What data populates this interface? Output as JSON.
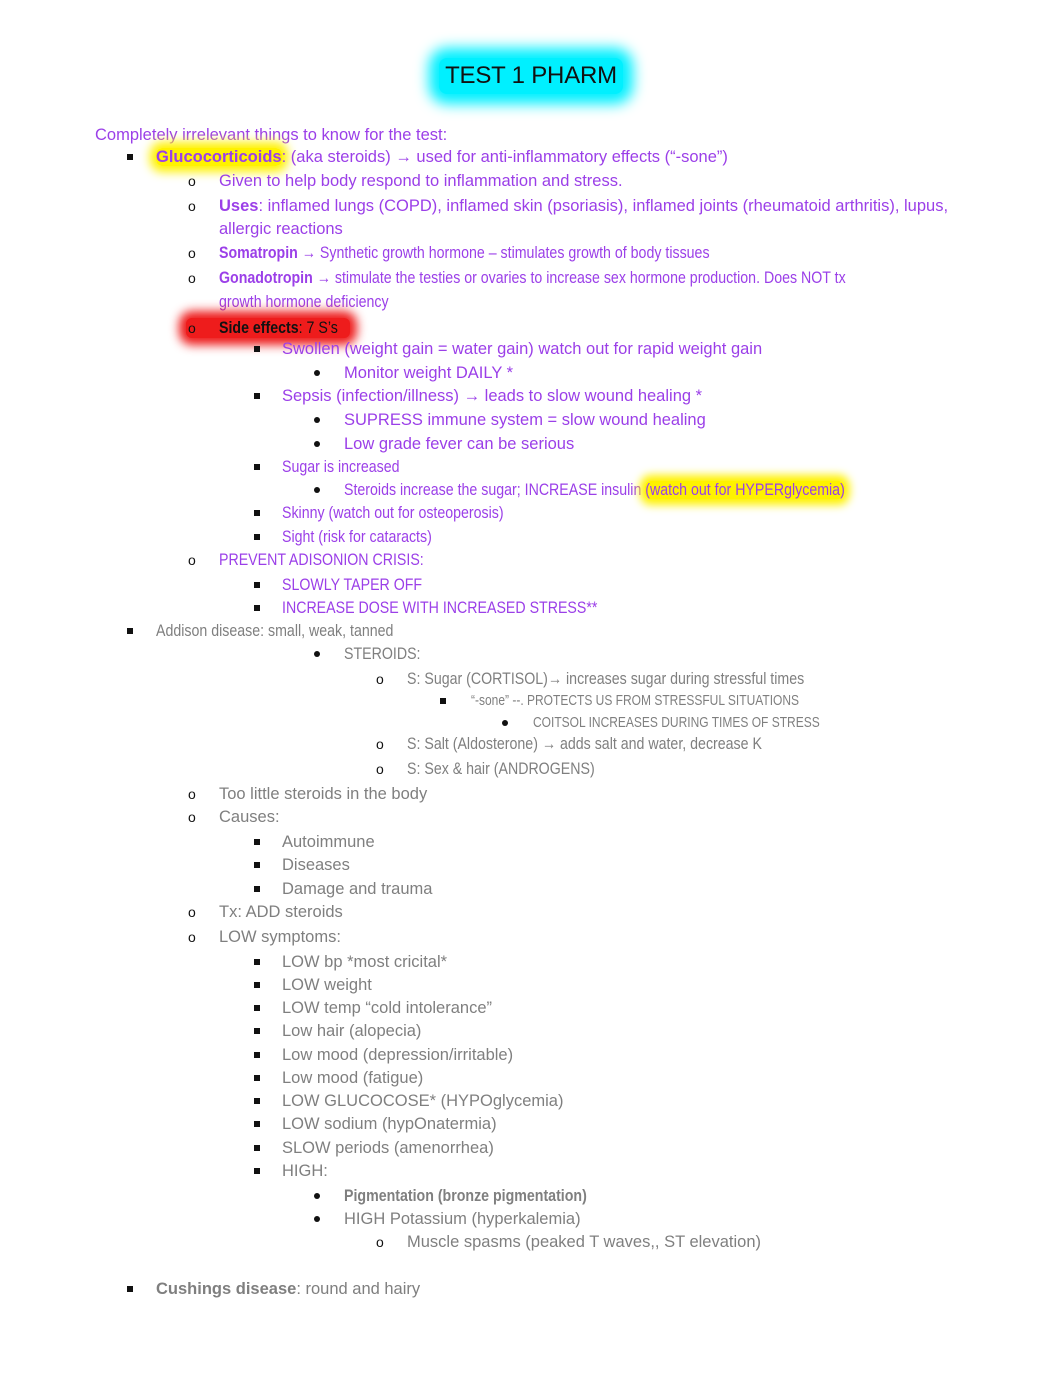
{
  "title": "TEST 1 PHARM",
  "intro": "Completely irrelevant things to know for the test:",
  "glucocorticoids": {
    "term": "Glucocorticoids",
    "rest": ": (aka steroids) → used for anti-inflammatory effects (“-sone”)",
    "given": "Given to help body respond to inflammation and stress.",
    "uses_term": "Uses",
    "uses_rest": ": inflamed lungs (COPD), inflamed skin (psoriasis), inflamed joints (rheumatoid arthritis), lupus,",
    "uses_cont": "allergic reactions",
    "somatropin_term": "Somatropin",
    "somatropin_rest": " → Synthetic growth hormone – stimulates growth of body tissues",
    "gonadotropin_term": "Gonadotropin",
    "gonadotropin_rest": " → stimulate the testies or ovaries to increase sex hormone production. Does NOT tx",
    "gonadotropin_cont": "growth hormone deficiency",
    "side_effects_term": "Side effects",
    "side_effects_rest": ": 7 S’s",
    "side_effects": [
      {
        "text": "Swollen (weight gain = water gain) watch out for rapid weight gain",
        "sub": [
          "Monitor weight DAILY *"
        ]
      },
      {
        "text": "Sepsis (infection/illness) → leads to slow wound healing *",
        "sub": [
          "SUPRESS immune system = slow wound healing",
          "Low grade fever can be serious"
        ]
      },
      {
        "text": "Sugar is increased",
        "sub_pre": "Steroids increase the sugar; INCREASE insulin ",
        "sub_hl": "(watch out for HYPERglycemia)"
      },
      {
        "text": "Skinny (watch out for osteoperosis)"
      },
      {
        "text": "Sight (risk for cataracts)"
      }
    ],
    "prevent": "PREVENT ADISONION CRISIS:",
    "prevent_items": [
      "SLOWLY TAPER OFF",
      "INCREASE DOSE WITH INCREASED STRESS**"
    ]
  },
  "addison": {
    "heading": "Addison disease: small, weak, tanned",
    "steroids": "STEROIDS:",
    "sugar": "S: Sugar (CORTISOL)→ increases sugar during stressful times",
    "sone": "“-sone” --. PROTECTS US FROM STRESSFUL SITUATIONS",
    "coitsol": "COITSOL INCREASES DURING TIMES OF STRESS",
    "salt": "S: Salt (Aldosterone) → adds salt and water, decrease K",
    "sex": "S: Sex & hair (ANDROGENS)",
    "too_little": "Too little steroids in the body",
    "causes": "Causes:",
    "causes_items": [
      "Autoimmune",
      "Diseases",
      "Damage and trauma"
    ],
    "tx": "Tx: ADD steroids",
    "low_symptoms": "LOW symptoms:",
    "low_items": [
      "LOW bp  *most cricital*",
      "LOW weight",
      "LOW temp “cold intolerance”",
      "Low hair (alopecia)",
      "Low mood (depression/irritable)",
      "Low mood (fatigue)",
      "LOW GLUCOCOSE*  (HYPOglycemia)",
      "LOW sodium (hypOnatermia)",
      "SLOW periods (amenorrhea)",
      "HIGH:"
    ],
    "high_items": [
      "Pigmentation (bronze pigmentation)",
      "HIGH Potassium (hyperkalemia)"
    ],
    "muscle": "Muscle spasms (peaked T waves,, ST elevation)"
  },
  "cushings": {
    "term": "Cushings disease",
    "rest": ": round and hairy"
  }
}
